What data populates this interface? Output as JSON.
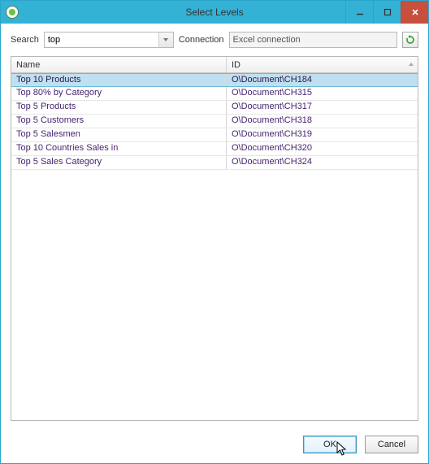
{
  "window": {
    "title": "Select Levels"
  },
  "toolbar": {
    "search_label": "Search",
    "search_value": "top",
    "connection_label": "Connection",
    "connection_value": "Excel connection"
  },
  "grid": {
    "columns": {
      "name": "Name",
      "id": "ID"
    },
    "rows": [
      {
        "name": "Top 10 Products",
        "id": "O\\Document\\CH184",
        "selected": true
      },
      {
        "name": "Top 80% by Category",
        "id": "O\\Document\\CH315"
      },
      {
        "name": "Top 5 Products",
        "id": "O\\Document\\CH317"
      },
      {
        "name": "Top 5 Customers",
        "id": "O\\Document\\CH318"
      },
      {
        "name": "Top 5 Salesmen",
        "id": "O\\Document\\CH319"
      },
      {
        "name": "Top 10 Countries Sales in",
        "id": "O\\Document\\CH320"
      },
      {
        "name": "Top 5 Sales Category",
        "id": "O\\Document\\CH324"
      }
    ]
  },
  "buttons": {
    "ok": "OK",
    "cancel": "Cancel"
  }
}
